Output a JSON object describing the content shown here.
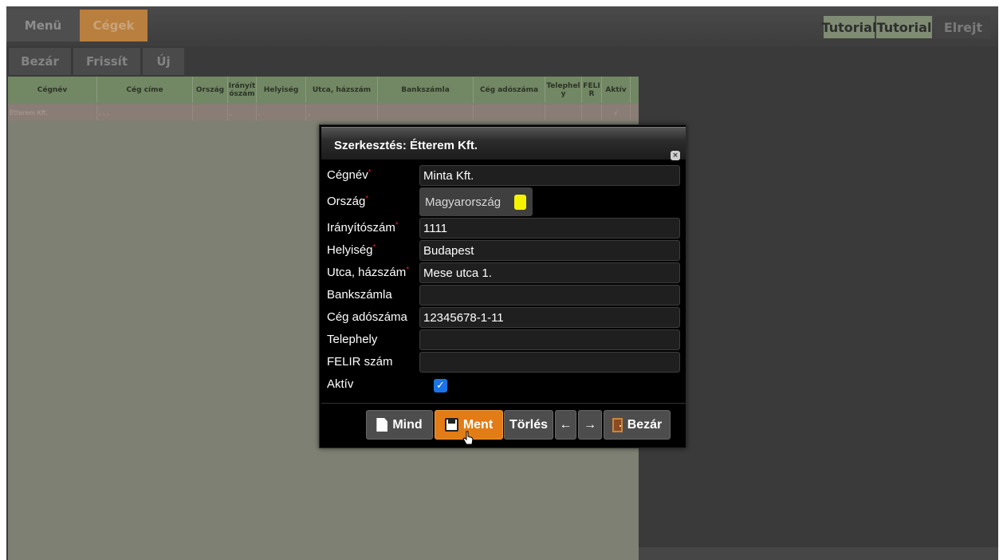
{
  "topbar": {
    "menu_label": "Menü",
    "cegek_label": "Cégek",
    "tutorial1_label": "Tutorial",
    "tutorial2_label": "Tutorial",
    "elrejt_label": "Elrejt"
  },
  "toolbar": {
    "bezar_label": "Bezár",
    "frissit_label": "Frissít",
    "uj_label": "Új"
  },
  "table": {
    "columns": [
      "Cégnév",
      "Cég címe",
      "Ország",
      "Irányít ószám",
      "Helyiség",
      "Utca, házszám",
      "Bankszámla",
      "Cég adószáma",
      "Telephel y",
      "FELI R",
      "Aktív"
    ],
    "row": [
      "Étterem Kft.",
      ", , ,",
      "",
      ",",
      ",",
      ",",
      "",
      "",
      "",
      "",
      "√"
    ]
  },
  "dialog": {
    "title": "Szerkesztés: Étterem Kft.",
    "close_glyph": "×",
    "fields": {
      "cegnev": {
        "label": "Cégnév",
        "value": "Minta Kft."
      },
      "orszag": {
        "label": "Ország",
        "value": "Magyarország"
      },
      "iranyitoszam": {
        "label": "Irányítószám",
        "value": "1111"
      },
      "helyiseg": {
        "label": "Helyiség",
        "value": "Budapest"
      },
      "utca": {
        "label": "Utca, házszám",
        "value": "Mese utca 1."
      },
      "bankszamla": {
        "label": "Bankszámla",
        "value": ""
      },
      "adoszam": {
        "label": "Cég adószáma",
        "value": "12345678-1-11"
      },
      "telephely": {
        "label": "Telephely",
        "value": ""
      },
      "felir": {
        "label": "FELIR szám",
        "value": ""
      },
      "aktiv": {
        "label": "Aktív",
        "checked": true
      }
    },
    "required_mark": "*",
    "buttons": {
      "mind": "Mind",
      "ment": "Ment",
      "torles": "Törlés",
      "prev": "←",
      "next": "→",
      "bezar": "Bezár"
    }
  },
  "colors": {
    "accent_orange": "#e37b16",
    "header_green": "#728764",
    "checkbox_blue": "#1a73e8"
  }
}
